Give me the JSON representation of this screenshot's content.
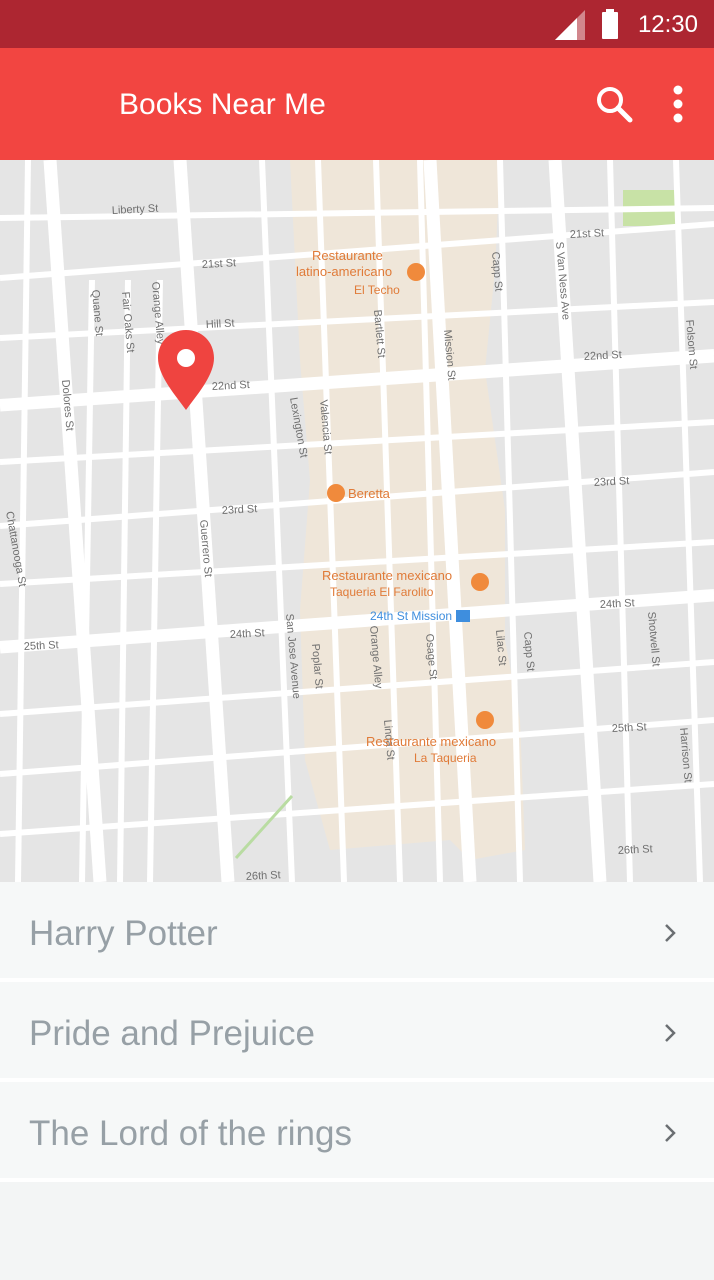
{
  "status_bar": {
    "time": "12:30",
    "icons": [
      "signal-icon",
      "battery-icon"
    ]
  },
  "app_bar": {
    "title": "Books Near Me",
    "actions": [
      "search-icon",
      "more-vert-icon"
    ]
  },
  "map": {
    "pin_icon": "location-pin-icon",
    "streets": [
      "Liberty St",
      "21st St",
      "Hill St",
      "22nd St",
      "23rd St",
      "24th St",
      "25th St",
      "26th St",
      "21st St",
      "22nd St",
      "23rd St",
      "24th St",
      "25th St",
      "26th St",
      "Dolores St",
      "Guerrero St",
      "Valencia St",
      "Bartlett St",
      "Mission St",
      "Capp St",
      "S Van Ness Ave",
      "Shotwell St",
      "Folsom St",
      "Orange Alley",
      "Osage St",
      "Lilac St",
      "Poplar St",
      "San Jose Avenue",
      "Fair Oaks St",
      "Chattanooga St",
      "Quane St",
      "Orange Alley",
      "Lexington St",
      "Linda St",
      "Capp St",
      "Harrison St"
    ],
    "places": [
      {
        "line1": "Restaurante",
        "line2": "latino-americano",
        "line3": "El Techo"
      },
      {
        "line1": "Beretta"
      },
      {
        "line1": "Restaurante mexicano",
        "line2": "Taqueria El Farolito"
      },
      {
        "line1": "24th St Mission"
      },
      {
        "line1": "Restaurante mexicano",
        "line2": "La Taqueria"
      }
    ]
  },
  "books": [
    {
      "title": "Harry Potter"
    },
    {
      "title": "Pride and Prejuice"
    },
    {
      "title": "The Lord of the rings"
    }
  ]
}
